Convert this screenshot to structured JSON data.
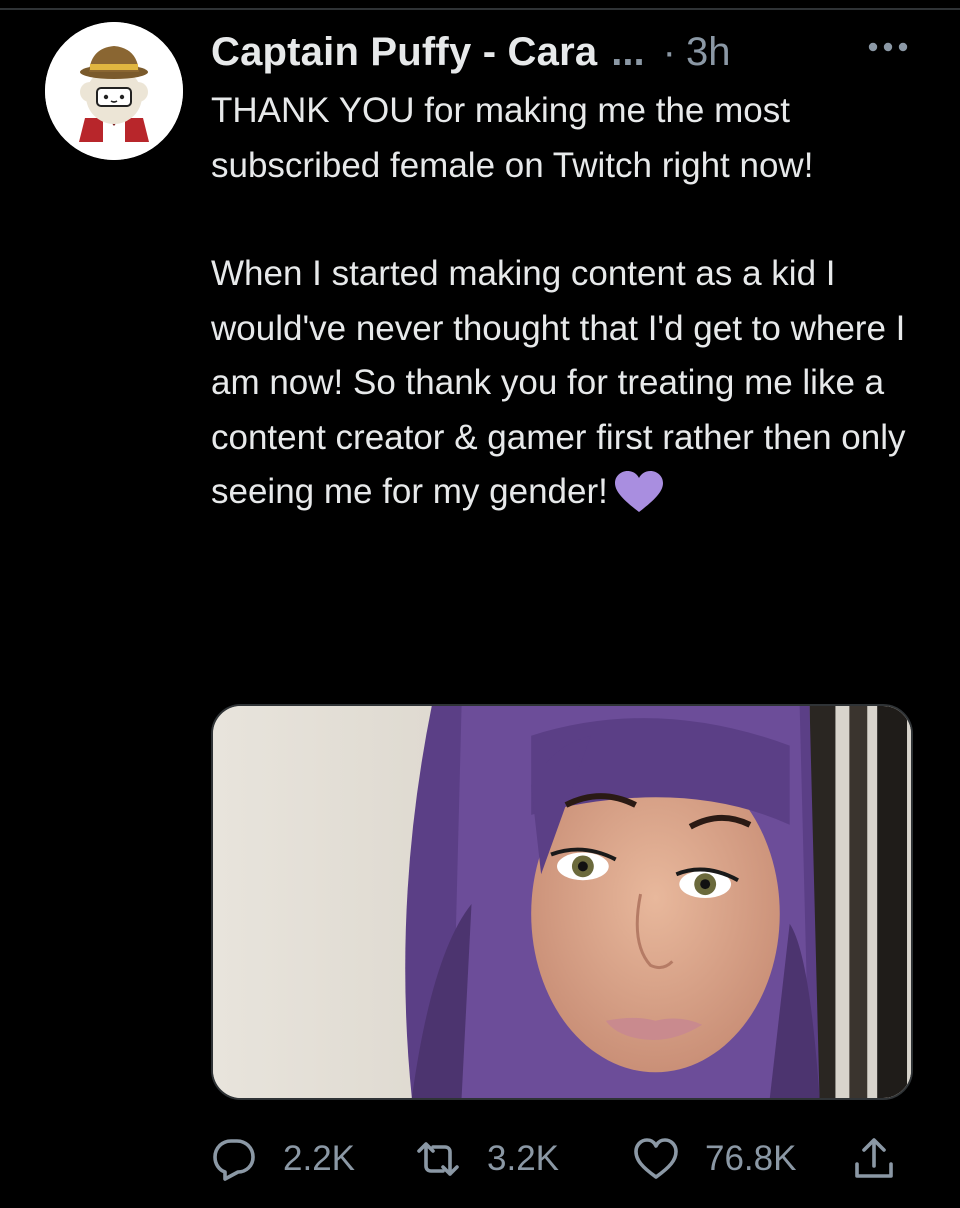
{
  "tweet": {
    "author_name": "Captain Puffy - Cara",
    "name_truncation": "...",
    "separator": "·",
    "time": "3h",
    "paragraph_1": "THANK YOU for making me the most subscribed female on Twitch right now!",
    "paragraph_2": "When I started making content as a kid I would've never thought that I'd get to where I am now! So thank you for treating me like a content creator & gamer first rather then only seeing me for my gender!",
    "emoji": "purple-heart"
  },
  "actions": {
    "replies": "2.2K",
    "retweets": "3.2K",
    "likes": "76.8K"
  },
  "icons": {
    "more": "more-horizontal-icon",
    "reply": "reply-icon",
    "retweet": "retweet-icon",
    "like": "heart-icon",
    "share": "share-icon"
  },
  "colors": {
    "background": "#000000",
    "text": "#e7e9ea",
    "secondary": "#8b98a5",
    "emoji_purple": "#a98ee0"
  }
}
